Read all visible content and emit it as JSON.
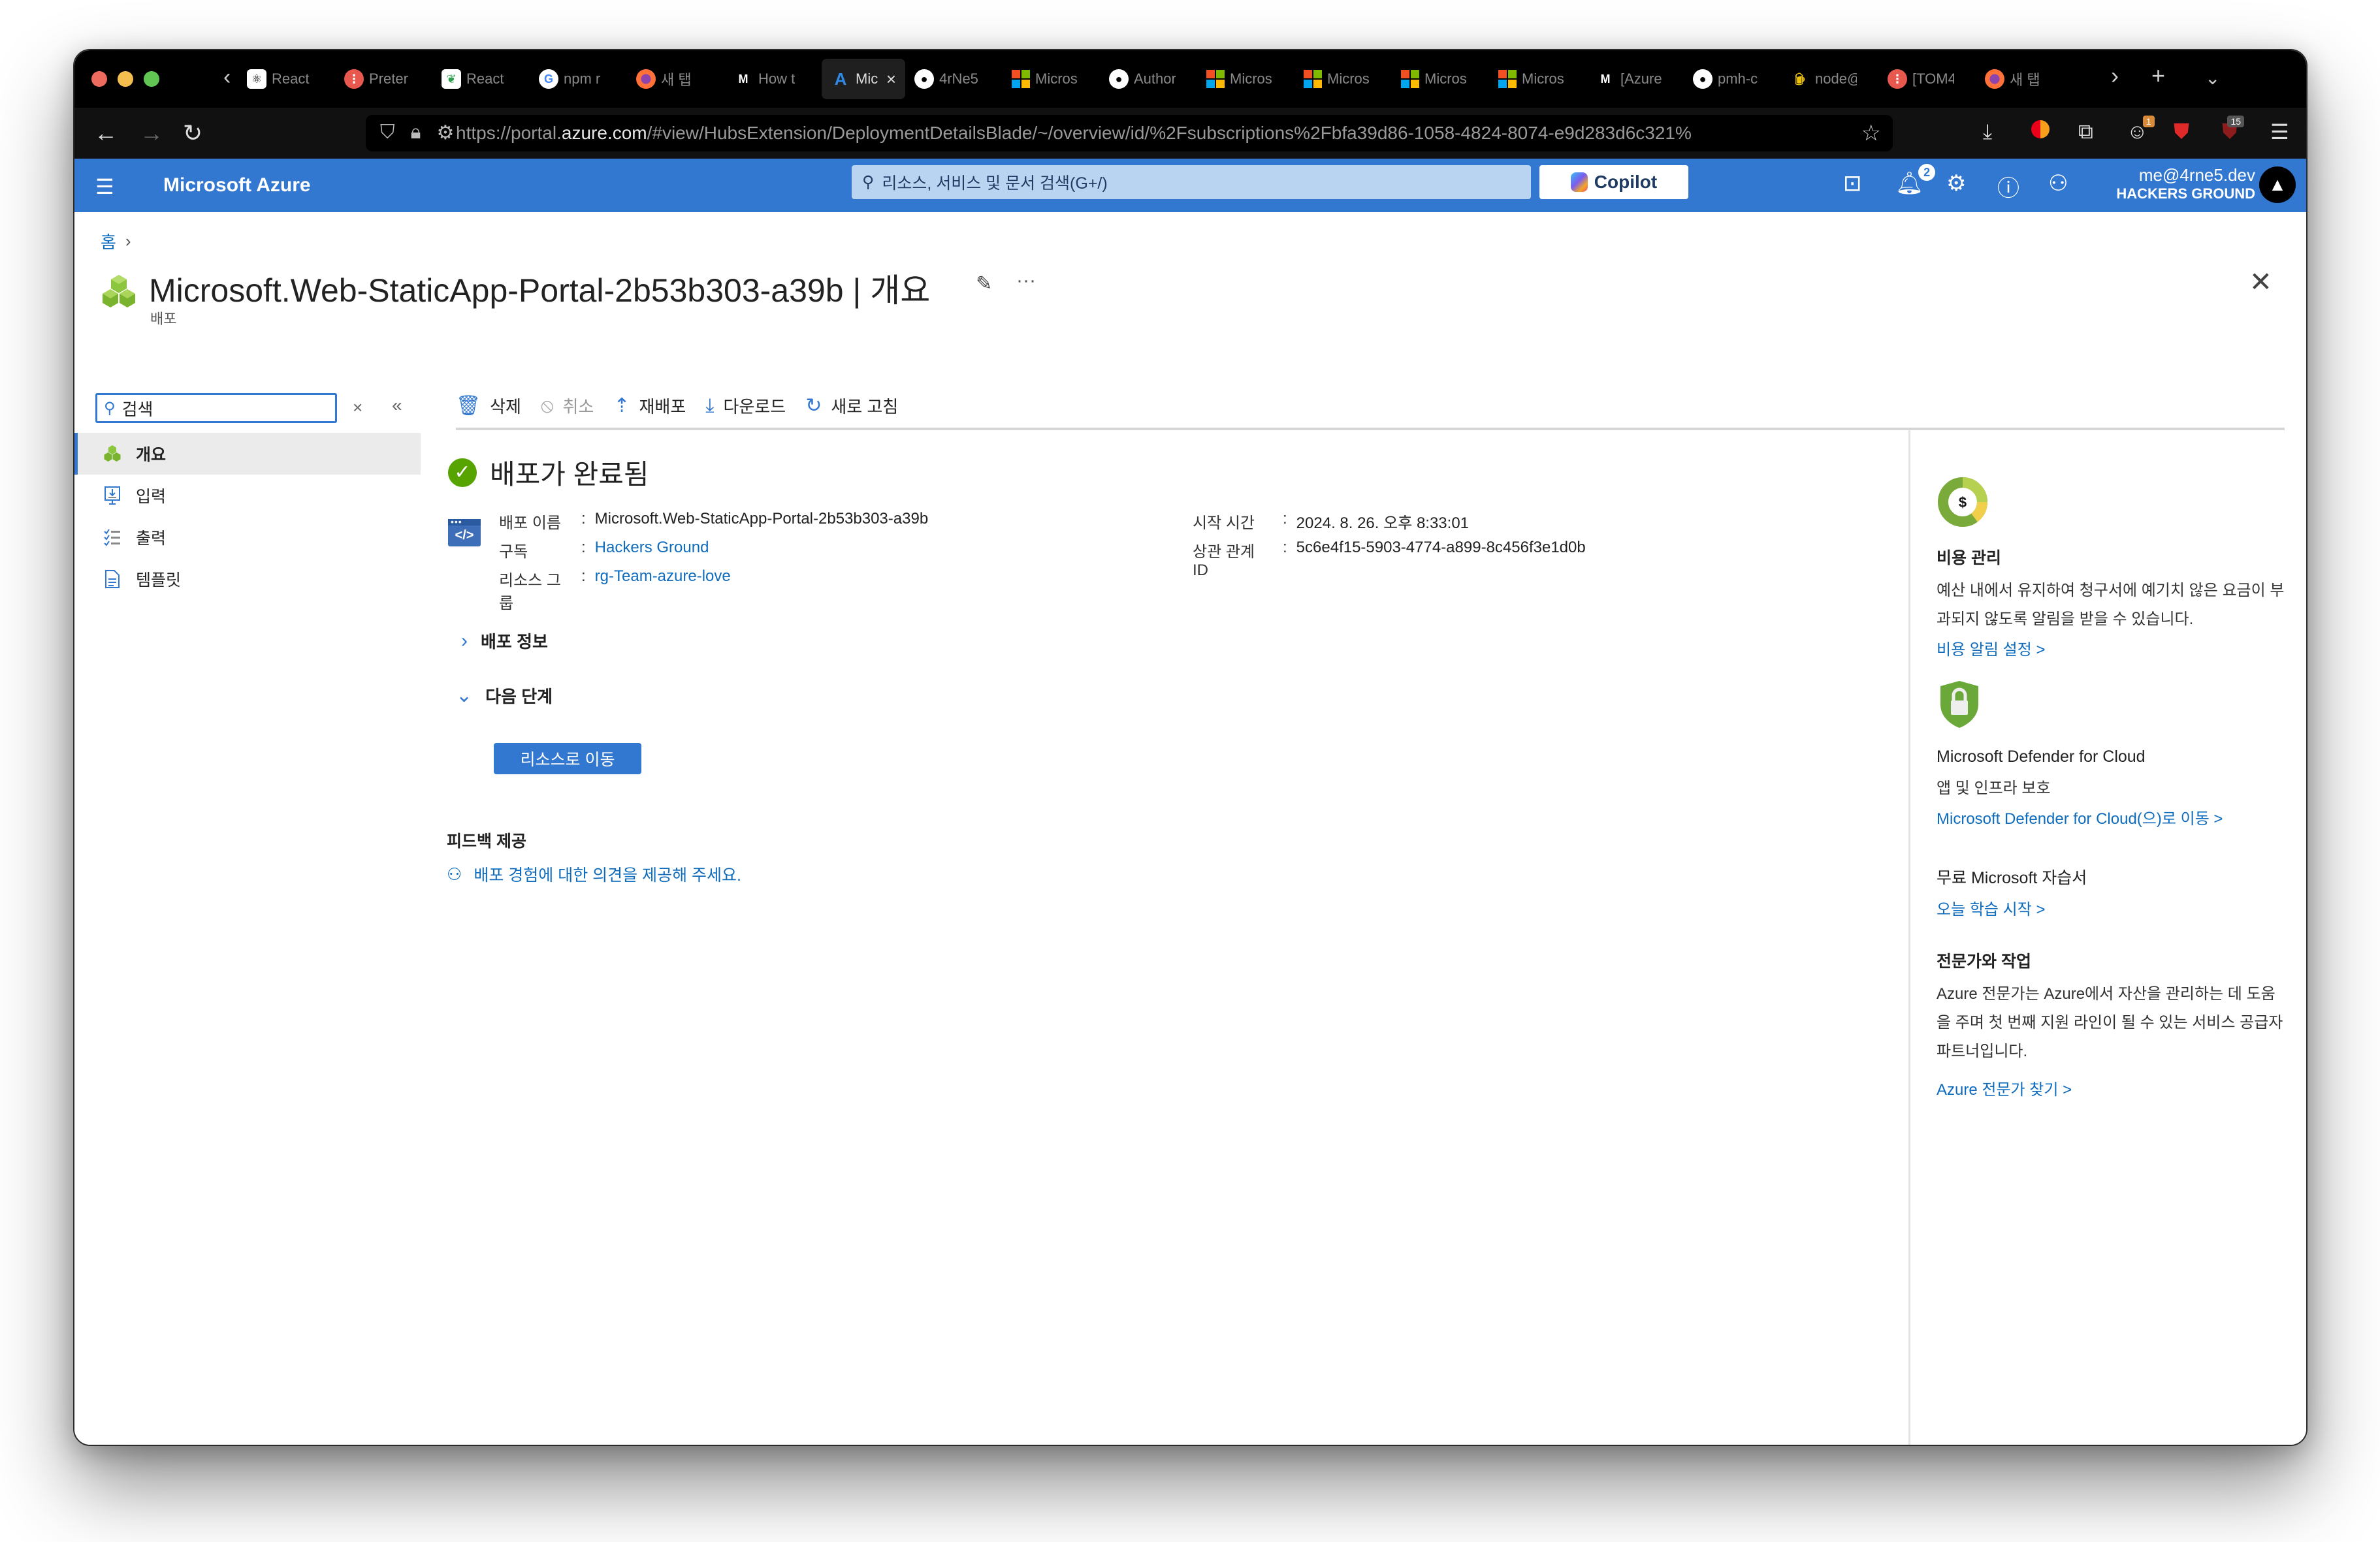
{
  "browser": {
    "tabs": [
      {
        "label": "React",
        "icon": "react-tab-icon"
      },
      {
        "label": "Preter",
        "icon": "pretendard-tab-icon"
      },
      {
        "label": "React",
        "icon": "react-tab-icon-2"
      },
      {
        "label": "npm r",
        "icon": "google-icon"
      },
      {
        "label": "새 탭",
        "icon": "firefox-icon"
      },
      {
        "label": "How t",
        "icon": "medium-icon"
      },
      {
        "label": "Mic",
        "icon": "azure-icon",
        "active": true
      },
      {
        "label": "4rNe5",
        "icon": "github-icon"
      },
      {
        "label": "Micros",
        "icon": "microsoft-icon"
      },
      {
        "label": "Author",
        "icon": "github-icon"
      },
      {
        "label": "Micros",
        "icon": "microsoft-icon"
      },
      {
        "label": "Micros",
        "icon": "microsoft-icon"
      },
      {
        "label": "Micros",
        "icon": "microsoft-icon"
      },
      {
        "label": "Micros",
        "icon": "microsoft-icon"
      },
      {
        "label": "[Azure",
        "icon": "medium-icon"
      },
      {
        "label": "pmh-c",
        "icon": "github-icon"
      },
      {
        "label": "node@",
        "icon": "beer-icon"
      },
      {
        "label": "[TOM4",
        "icon": "pretendard-tab-icon"
      },
      {
        "label": "새 탭",
        "icon": "firefox-icon"
      }
    ],
    "url_prefix": "https://portal.",
    "url_domain": "azure.com",
    "url_rest": "/#view/HubsExtension/DeploymentDetailsBlade/~/overview/id/%2Fsubscriptions%2Fbfa39d86-1058-4824-8074-e9d283d6c321%",
    "extension_badges": {
      "extension_1": "1",
      "ublock": "15"
    }
  },
  "azure_header": {
    "brand": "Microsoft Azure",
    "search_placeholder": "리소스, 서비스 및 문서 검색(G+/)",
    "copilot_label": "Copilot",
    "notification_count": "2",
    "account_email": "me@4rne5.dev",
    "account_tenant": "HACKERS GROUND"
  },
  "breadcrumb": {
    "home": "홈"
  },
  "blade": {
    "title": "Microsoft.Web-StaticApp-Portal-2b53b303-a39b | 개요",
    "subtitle": "배포"
  },
  "sidebar": {
    "search_value": "검색",
    "items": [
      {
        "label": "개요",
        "icon": "overview-cubes-icon",
        "active": true
      },
      {
        "label": "입력",
        "icon": "input-icon"
      },
      {
        "label": "출력",
        "icon": "output-checklist-icon"
      },
      {
        "label": "템플릿",
        "icon": "template-document-icon"
      }
    ]
  },
  "toolbar": {
    "delete": "삭제",
    "cancel": "취소",
    "redeploy": "재배포",
    "download": "다운로드",
    "refresh": "새로 고침"
  },
  "status": {
    "text": "배포가 완료됨",
    "color": "#57a300"
  },
  "details": {
    "deployment_name_label": "배포 이름",
    "deployment_name": "Microsoft.Web-StaticApp-Portal-2b53b303-a39b",
    "subscription_label": "구독",
    "subscription": "Hackers Ground",
    "resource_group_label": "리소스 그룹",
    "resource_group": "rg-Team-azure-love",
    "start_time_label": "시작 시간",
    "start_time": "2024. 8. 26. 오후 8:33:01",
    "correlation_id_label": "상관 관계 ID",
    "correlation_id": "5c6e4f15-5903-4774-a899-8c456f3e1d0b",
    "separator": ":"
  },
  "sections": {
    "deployment_info": "배포 정보",
    "next_steps": "다음 단계",
    "go_to_resource": "리소스로 이동"
  },
  "feedback": {
    "title": "피드백 제공",
    "link": "배포 경험에 대한 의견을 제공해 주세요."
  },
  "right_panel": {
    "cost": {
      "title": "비용 관리",
      "description": "예산 내에서 유지하여 청구서에 예기치 않은 요금이 부과되지 않도록 알림을 받을 수 있습니다.",
      "link": "비용 알림 설정 >"
    },
    "defender": {
      "title": "Microsoft Defender for Cloud",
      "description": "앱 및 인프라 보호",
      "link": "Microsoft Defender for Cloud(으)로 이동 >"
    },
    "learn": {
      "title": "무료 Microsoft 자습서",
      "link": "오늘 학습 시작 >"
    },
    "experts": {
      "title": "전문가와 작업",
      "description": "Azure 전문가는 Azure에서 자산을 관리하는 데 도움을 주며 첫 번째 지원 라인이 될 수 있는 서비스 공급자 파트너입니다.",
      "link": "Azure 전문가 찾기 >"
    }
  },
  "colors": {
    "azure_blue": "#3277d0",
    "link": "#0f6cbd",
    "success": "#57a300"
  }
}
